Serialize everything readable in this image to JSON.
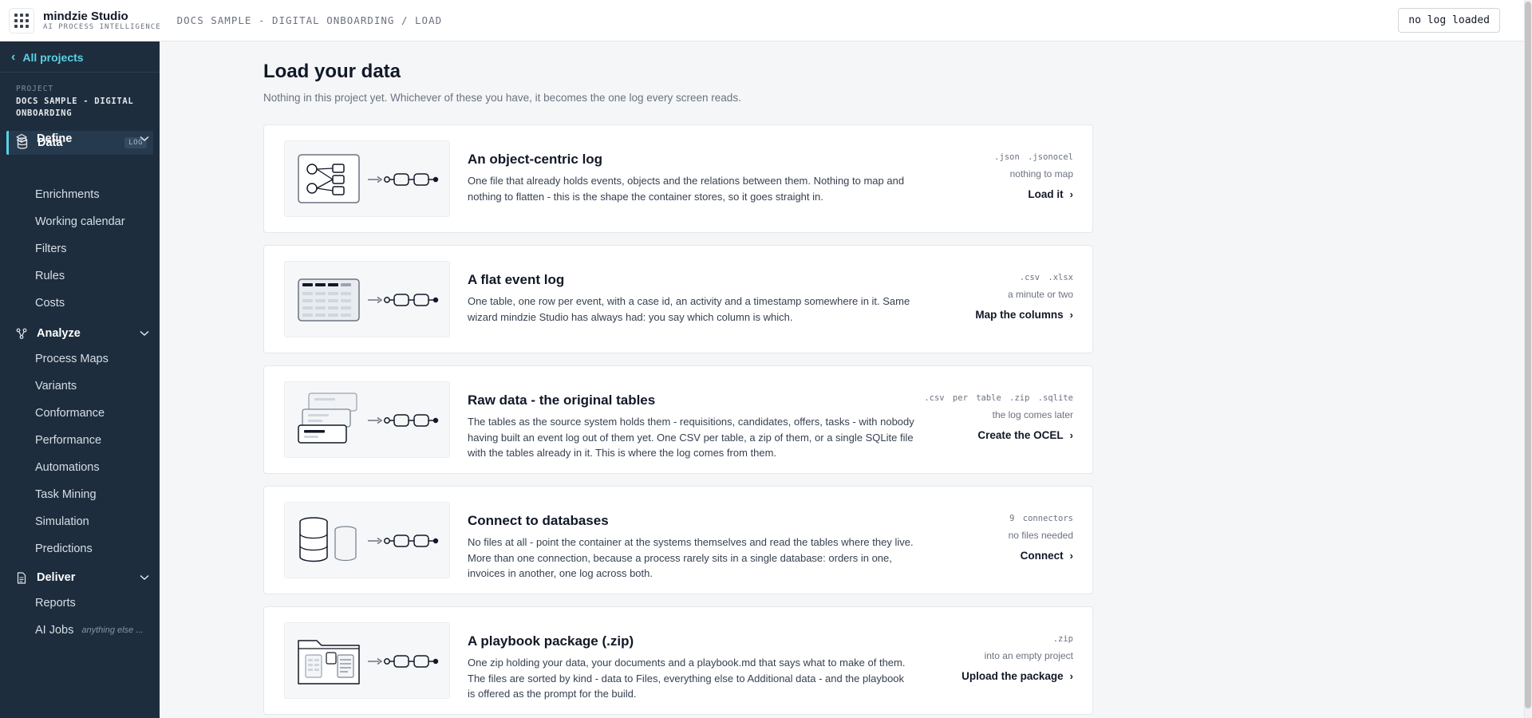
{
  "app": {
    "name": "mindzie Studio",
    "tagline": "AI PROCESS INTELLIGENCE",
    "breadcrumb": "DOCS SAMPLE - DIGITAL ONBOARDING / LOAD",
    "log_status": "no log loaded"
  },
  "sidebar": {
    "back_label": "All projects",
    "project_kicker": "PROJECT",
    "project_name": "DOCS SAMPLE - DIGITAL ONBOARDING",
    "data_label": "Data",
    "data_badge": "LOG",
    "define": {
      "label": "Define",
      "items": [
        "Enrichments",
        "Working calendar",
        "Filters",
        "Rules",
        "Costs"
      ]
    },
    "analyze": {
      "label": "Analyze",
      "items": [
        "Process Maps",
        "Variants",
        "Conformance",
        "Performance",
        "Automations",
        "Task Mining",
        "Simulation",
        "Predictions"
      ]
    },
    "deliver": {
      "label": "Deliver",
      "items": [
        "Reports",
        "AI Jobs"
      ],
      "ai_jobs_hint": "anything else ..."
    }
  },
  "main": {
    "title": "Load your data",
    "subtitle": "Nothing in this project yet. Whichever of these you have, it becomes the one log every screen reads.",
    "cards": [
      {
        "title": "An object-centric log",
        "description": "One file that already holds events, objects and the relations between them. Nothing to map and nothing to flatten - this is the shape the container stores, so it goes straight in.",
        "exts": ".json .jsonocel",
        "note": "nothing to map",
        "action": "Load it",
        "illustration": "object-centric-icon"
      },
      {
        "title": "A flat event log",
        "description": "One table, one row per event, with a case id, an activity and a timestamp somewhere in it. Same wizard mindzie Studio has always had: you say which column is which.",
        "exts": ".csv .xlsx",
        "note": "a minute or two",
        "action": "Map the columns",
        "illustration": "table-icon"
      },
      {
        "title": "Raw data - the original tables",
        "description": "The tables as the source system holds them - requisitions, candidates, offers, tasks - with nobody having built an event log out of them yet. One CSV per table, a zip of them, or a single SQLite file with the tables already in it. This is where the log comes from them.",
        "exts": ".csv per table .zip .sqlite",
        "note": "the log comes later",
        "action": "Create the OCEL",
        "illustration": "stacked-tables-icon"
      },
      {
        "title": "Connect to databases",
        "description": "No files at all - point the container at the systems themselves and read the tables where they live. More than one connection, because a process rarely sits in a single database: orders in one, invoices in another, one log across both.",
        "exts": "9 connectors",
        "note": "no files needed",
        "action": "Connect",
        "illustration": "database-icon"
      },
      {
        "title": "A playbook package (.zip)",
        "description": "One zip holding your data, your documents and a playbook.md that says what to make of them. The files are sorted by kind - data to Files, everything else to Additional data - and the playbook is offered as the prompt for the build.",
        "exts": ".zip",
        "note": "into an empty project",
        "action": "Upload the package",
        "illustration": "folder-icon"
      }
    ]
  }
}
